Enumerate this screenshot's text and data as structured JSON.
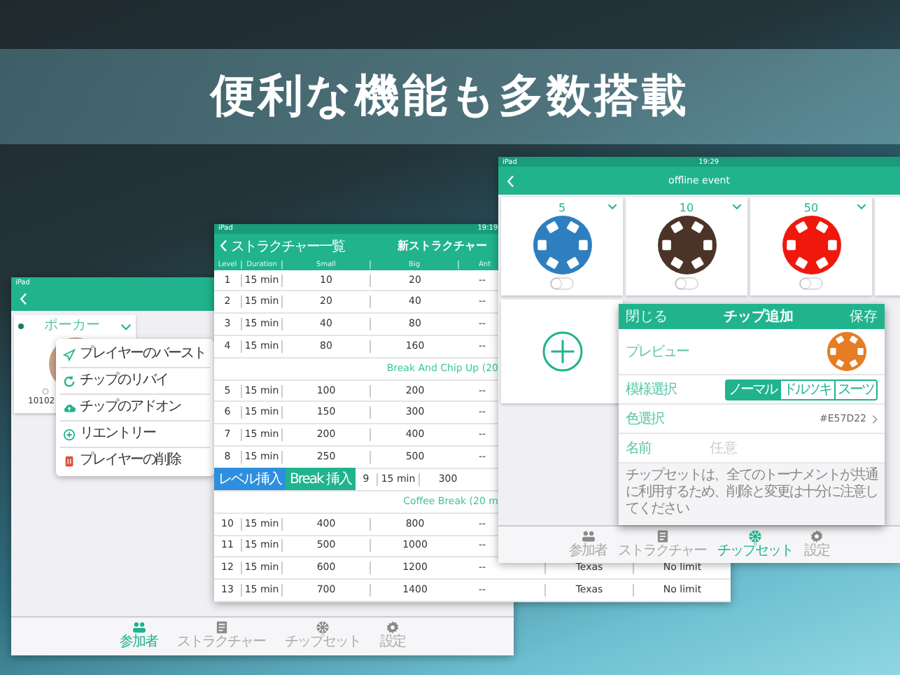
{
  "headline": "便利な機能も多数搭載",
  "player_screen": {
    "status_bar": {
      "carrier": "iPad"
    },
    "player_card": {
      "name": "ポーカー",
      "id": "10102"
    },
    "menu": [
      {
        "label": "プレイヤーのバースト"
      },
      {
        "label": "チップのリバイ"
      },
      {
        "label": "チップのアドオン"
      },
      {
        "label": "リエントリー"
      },
      {
        "label": "プレイヤーの削除"
      }
    ],
    "tab_bar": [
      {
        "label": "参加者",
        "selected": true
      },
      {
        "label": "ストラクチャー",
        "selected": false
      },
      {
        "label": "チップセット",
        "selected": false
      },
      {
        "label": "設定",
        "selected": false
      }
    ]
  },
  "structure_screen": {
    "status_bar": {
      "carrier": "iPad",
      "time": "19:19"
    },
    "back_label": "ストラクチャー一覧",
    "title": "新ストラクチャー",
    "columns": [
      "Level",
      "Duration",
      "Small",
      "Big",
      "Ant"
    ],
    "rows": [
      {
        "kind": "level",
        "cells": [
          "1",
          "15 min",
          "10",
          "20",
          "--"
        ]
      },
      {
        "kind": "level",
        "cells": [
          "2",
          "15 min",
          "20",
          "40",
          "--"
        ]
      },
      {
        "kind": "level",
        "cells": [
          "3",
          "15 min",
          "40",
          "80",
          "--"
        ]
      },
      {
        "kind": "level",
        "cells": [
          "4",
          "15 min",
          "80",
          "160",
          "--"
        ]
      },
      {
        "kind": "break",
        "label": "Break And Chip Up (20"
      },
      {
        "kind": "level",
        "cells": [
          "5",
          "15 min",
          "100",
          "200",
          "--"
        ]
      },
      {
        "kind": "level",
        "cells": [
          "6",
          "15 min",
          "150",
          "300",
          "--"
        ]
      },
      {
        "kind": "level",
        "cells": [
          "7",
          "15 min",
          "200",
          "400",
          "--"
        ]
      },
      {
        "kind": "level",
        "cells": [
          "8",
          "15 min",
          "250",
          "500",
          "--"
        ]
      },
      {
        "kind": "insert",
        "actions": [
          {
            "label": "レベル挿入",
            "kind": "level"
          },
          {
            "label": "Break 挿入",
            "kind": "break"
          }
        ],
        "cells": [
          "9",
          "15 min",
          "300"
        ]
      },
      {
        "kind": "break",
        "label": "Coffee Break (20 m"
      },
      {
        "kind": "level",
        "cells": [
          "10",
          "15 min",
          "400",
          "800",
          "--"
        ]
      },
      {
        "kind": "level",
        "cells": [
          "11",
          "15 min",
          "500",
          "1000",
          "--"
        ]
      },
      {
        "kind": "level",
        "cells": [
          "12",
          "15 min",
          "600",
          "1200",
          "--",
          "Texas",
          "No limit"
        ]
      },
      {
        "kind": "level",
        "cells": [
          "13",
          "15 min",
          "700",
          "1400",
          "--",
          "Texas",
          "No limit"
        ]
      }
    ]
  },
  "chip_screen": {
    "status_bar": {
      "carrier": "iPad",
      "time": "19:29"
    },
    "title": "offline event",
    "chips": [
      {
        "value": "5",
        "color": "#2f7fc0",
        "on": false
      },
      {
        "value": "10",
        "color": "#4b3427",
        "on": false
      },
      {
        "value": "50",
        "color": "#f0180c",
        "on": false
      }
    ],
    "dialog": {
      "close": "閉じる",
      "title": "チップ追加",
      "save": "保存",
      "preview_label": "プレビュー",
      "pattern_label": "模様選択",
      "patterns": [
        {
          "label": "ノーマル",
          "selected": true
        },
        {
          "label": "ドルツキ",
          "selected": false
        },
        {
          "label": "スーツ",
          "selected": false
        }
      ],
      "color_label": "色選択",
      "color_value": "#E57D22",
      "name_label": "名前",
      "name_placeholder": "任意",
      "note": "チップセットは、全てのトーナメントが共通に利用するため、削除と変更は十分に注意してください"
    },
    "tab_bar": [
      {
        "label": "参加者",
        "selected": false
      },
      {
        "label": "ストラクチャー",
        "selected": false
      },
      {
        "label": "チップセット",
        "selected": true
      },
      {
        "label": "設定",
        "selected": false
      }
    ]
  }
}
